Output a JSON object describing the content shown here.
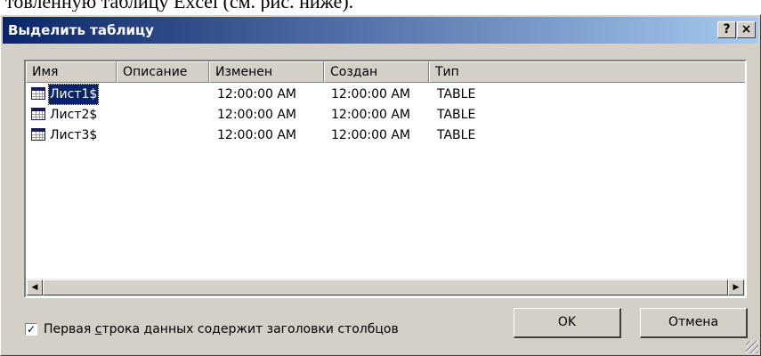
{
  "background_text": "товленную таблицу Excel (см. рис. ниже).",
  "dialog": {
    "title": "Выделить таблицу",
    "help_button": "?",
    "close_button": "×"
  },
  "table": {
    "columns": [
      "Имя",
      "Описание",
      "Изменен",
      "Создан",
      "Тип"
    ],
    "rows": [
      {
        "name": "Лист1$",
        "description": "",
        "modified": "12:00:00 AM",
        "created": "12:00:00 AM",
        "type": "TABLE",
        "selected": true
      },
      {
        "name": "Лист2$",
        "description": "",
        "modified": "12:00:00 AM",
        "created": "12:00:00 AM",
        "type": "TABLE",
        "selected": false
      },
      {
        "name": "Лист3$",
        "description": "",
        "modified": "12:00:00 AM",
        "created": "12:00:00 AM",
        "type": "TABLE",
        "selected": false
      }
    ],
    "row_icon": "table-icon"
  },
  "scrollbar": {
    "left_arrow": "◀",
    "right_arrow": "▶"
  },
  "checkbox": {
    "checked": true,
    "mark": "✓",
    "label_before": "Первая ",
    "label_accel": "с",
    "label_after": "трока данных содержит заголовки столбцов"
  },
  "buttons": {
    "ok": "OK",
    "cancel": "Отмена"
  }
}
